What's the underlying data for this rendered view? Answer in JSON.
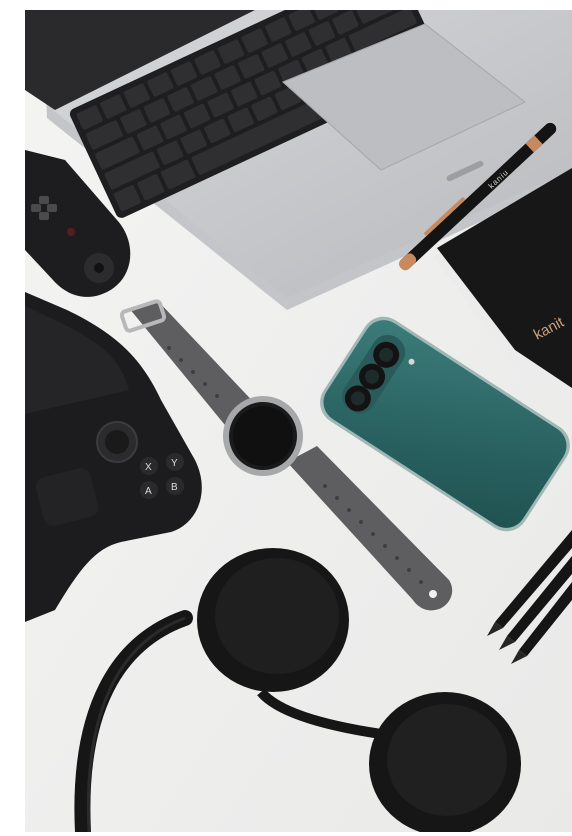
{
  "image": {
    "kind": "flat-lay photograph",
    "background_color": "#f1f1f0",
    "objects": [
      {
        "name": "laptop",
        "color": "#c9cacc"
      },
      {
        "name": "game-controller-grip",
        "color": "#1d1d1f"
      },
      {
        "name": "handheld-gaming-console",
        "color": "#1c1c1e"
      },
      {
        "name": "smartwatch",
        "color": "#5e5e60"
      },
      {
        "name": "smartphone",
        "color": "#2d6b6a"
      },
      {
        "name": "pen",
        "color": "#121212"
      },
      {
        "name": "notebook",
        "color": "#171717"
      },
      {
        "name": "pencils",
        "color": "#151515"
      },
      {
        "name": "headphones",
        "color": "#161616"
      }
    ],
    "printed_text": {
      "pen_brand": "kaniu",
      "notebook_brand": "kanit"
    },
    "console_buttons": [
      "X",
      "Y",
      "A",
      "B"
    ]
  }
}
